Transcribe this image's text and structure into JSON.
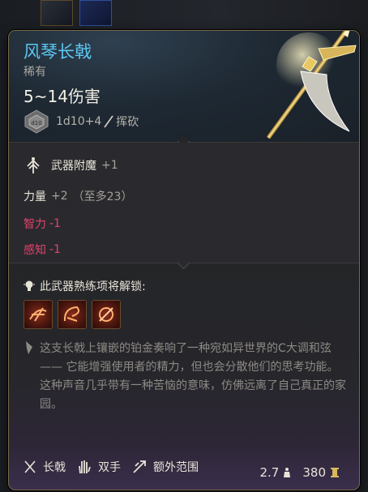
{
  "item": {
    "name": "风琴长戟",
    "rarity": "稀有",
    "damage": "5~14伤害",
    "dice": "1d10+4",
    "damage_type": "挥砍",
    "name_color": "#5cc7f2"
  },
  "properties": {
    "enchant_label": "武器附魔",
    "enchant_value": "+1",
    "strength_label": "力量",
    "strength_value": "+2",
    "strength_note": "（至多23）",
    "int_label": "智力",
    "int_value": "-1",
    "wis_label": "感知",
    "wis_value": "-1",
    "negative_color": "#e0426a"
  },
  "proficiency": {
    "title": "此武器熟练项将解锁:",
    "actions": [
      "action-1-icon",
      "action-2-icon",
      "action-3-icon"
    ],
    "description": "这支长戟上镶嵌的铂金奏响了一种宛如异世界的C大调和弦 —— 它能增强使用者的精力，但也会分散他们的思考功能。这种声音几乎带有一种苦恼的意味，仿佛远离了自己真正的家园。"
  },
  "tags": {
    "weapon_type": "长戟",
    "handed": "双手",
    "reach": "额外范围"
  },
  "footer": {
    "weight": "2.7",
    "price": "380"
  }
}
